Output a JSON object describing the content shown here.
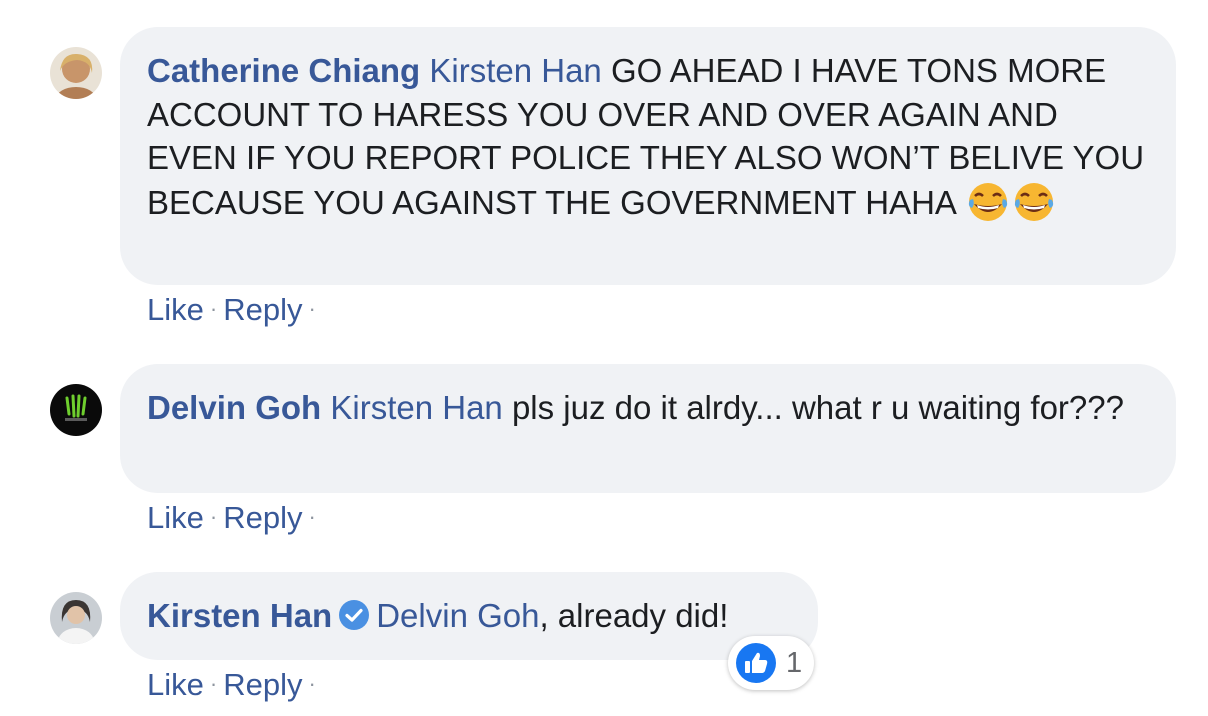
{
  "comments": [
    {
      "author": "Catherine Chiang",
      "mention": "Kirsten Han",
      "text": " GO AHEAD I HAVE TONS MORE ACCOUNT TO HARESS YOU OVER AND OVER AGAIN AND EVEN IF YOU REPORT POLICE THEY ALSO WON’T BELIVE YOU BECAUSE YOU AGAINST THE GOVERNMENT HAHA",
      "emoji": [
        "face-with-tears-of-joy-icon",
        "face-with-tears-of-joy-icon"
      ],
      "like_label": "Like",
      "reply_label": "Reply",
      "separator": "·"
    },
    {
      "author": "Delvin Goh",
      "mention": "Kirsten Han",
      "text": " pls juz do it alrdy... what r u waiting for???",
      "like_label": "Like",
      "reply_label": "Reply",
      "separator": "·"
    },
    {
      "author": "Kirsten Han",
      "verified": true,
      "mention": "Delvin Goh",
      "text": ", already did!",
      "like_label": "Like",
      "reply_label": "Reply",
      "separator": "·",
      "reactions": {
        "type": "like",
        "count": "1"
      }
    }
  ],
  "colors": {
    "link": "#385898",
    "bubble": "#f0f2f5",
    "text": "#1c1e21",
    "verified": "#4a90e2",
    "like_reaction": "#1877f2"
  }
}
